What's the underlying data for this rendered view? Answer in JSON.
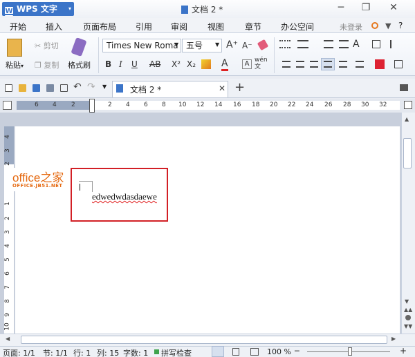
{
  "titlebar": {
    "app_name": "WPS 文字",
    "app_dropdown": "▾",
    "doc_title": "文档 2 *",
    "minimize": "─",
    "restore": "❐",
    "close": "✕"
  },
  "menu": {
    "items": [
      "开始",
      "插入",
      "页面布局",
      "引用",
      "审阅",
      "视图",
      "章节",
      "办公空间"
    ],
    "login": "未登录",
    "help": "?"
  },
  "ribbon": {
    "paste": "粘贴",
    "paste_dd": "▾",
    "cut": "剪切",
    "copy": "复制",
    "format_painter": "格式刷",
    "font_name": "Times New Roma",
    "font_size": "五号",
    "bold": "B",
    "italic": "I",
    "underline": "U",
    "strike": "AB",
    "superscript": "X²",
    "subscript": "X₂",
    "font_color": "A",
    "grow": "A⁺",
    "shrink": "A⁻",
    "wen": "wén 文"
  },
  "quicktoolbar": {
    "doc_tab": "文档 2 *",
    "tab_close": "✕",
    "new_tab": "+"
  },
  "ruler": {
    "h_numbers": [
      "6",
      "4",
      "2",
      "2",
      "4",
      "6",
      "8",
      "10",
      "12",
      "14",
      "16",
      "18",
      "20",
      "22",
      "24",
      "26",
      "28",
      "30",
      "32"
    ],
    "v_numbers": [
      "4",
      "3",
      "2",
      "1",
      "2",
      "3",
      "4",
      "5",
      "6",
      "7",
      "8",
      "9",
      "10"
    ]
  },
  "document": {
    "text": "edwedwdasdaewe"
  },
  "watermark": {
    "logo": "office之家",
    "sub": "OFFICE.JB51.NET"
  },
  "statusbar": {
    "page": "页面: 1/1",
    "section": "节: 1/1",
    "row": "行: 1",
    "col": "列: 15",
    "words": "字数: 1",
    "spell": "拼写检查",
    "zoom": "100 %",
    "minus": "─",
    "plus": "+"
  },
  "colors": {
    "accent": "#3b74c8",
    "highlight_box": "#d21f25",
    "watermark": "#e56a12"
  }
}
